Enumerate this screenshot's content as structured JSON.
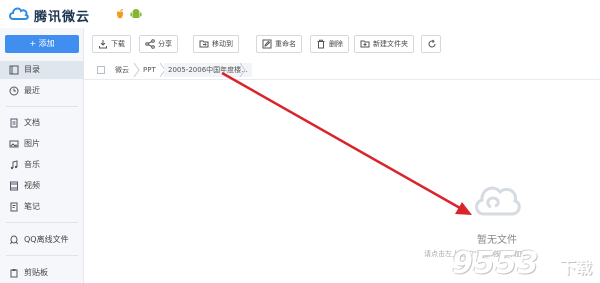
{
  "app": {
    "brand": "腾讯微云",
    "platforms": [
      "apple-icon",
      "android-icon"
    ]
  },
  "sidebar": {
    "add_label": "+ 添加",
    "items": [
      {
        "label": "目录",
        "icon": "directory-icon",
        "active": true
      },
      {
        "label": "最近",
        "icon": "clock-icon"
      },
      {
        "label": "文档",
        "icon": "document-icon"
      },
      {
        "label": "图片",
        "icon": "image-icon"
      },
      {
        "label": "音乐",
        "icon": "music-icon"
      },
      {
        "label": "视频",
        "icon": "video-icon"
      },
      {
        "label": "笔记",
        "icon": "note-icon"
      },
      {
        "label": "QQ离线文件",
        "icon": "qq-icon"
      },
      {
        "label": "剪贴板",
        "icon": "clipboard-icon"
      }
    ]
  },
  "toolbar": {
    "download": "下载",
    "share": "分享",
    "move_to": "移动到",
    "rename": "重命名",
    "delete": "删除",
    "new_folder": "新建文件夹"
  },
  "breadcrumb": [
    "微云",
    "PPT",
    "2005-2006中国年度楼..."
  ],
  "empty": {
    "title": "暂无文件",
    "hint": "请点击左上角的\"添加\"按钮添加"
  },
  "watermark": {
    "main": "9553",
    "sub": "下载"
  },
  "colors": {
    "accent": "#3f8ef0",
    "arrow": "#d9242b"
  }
}
